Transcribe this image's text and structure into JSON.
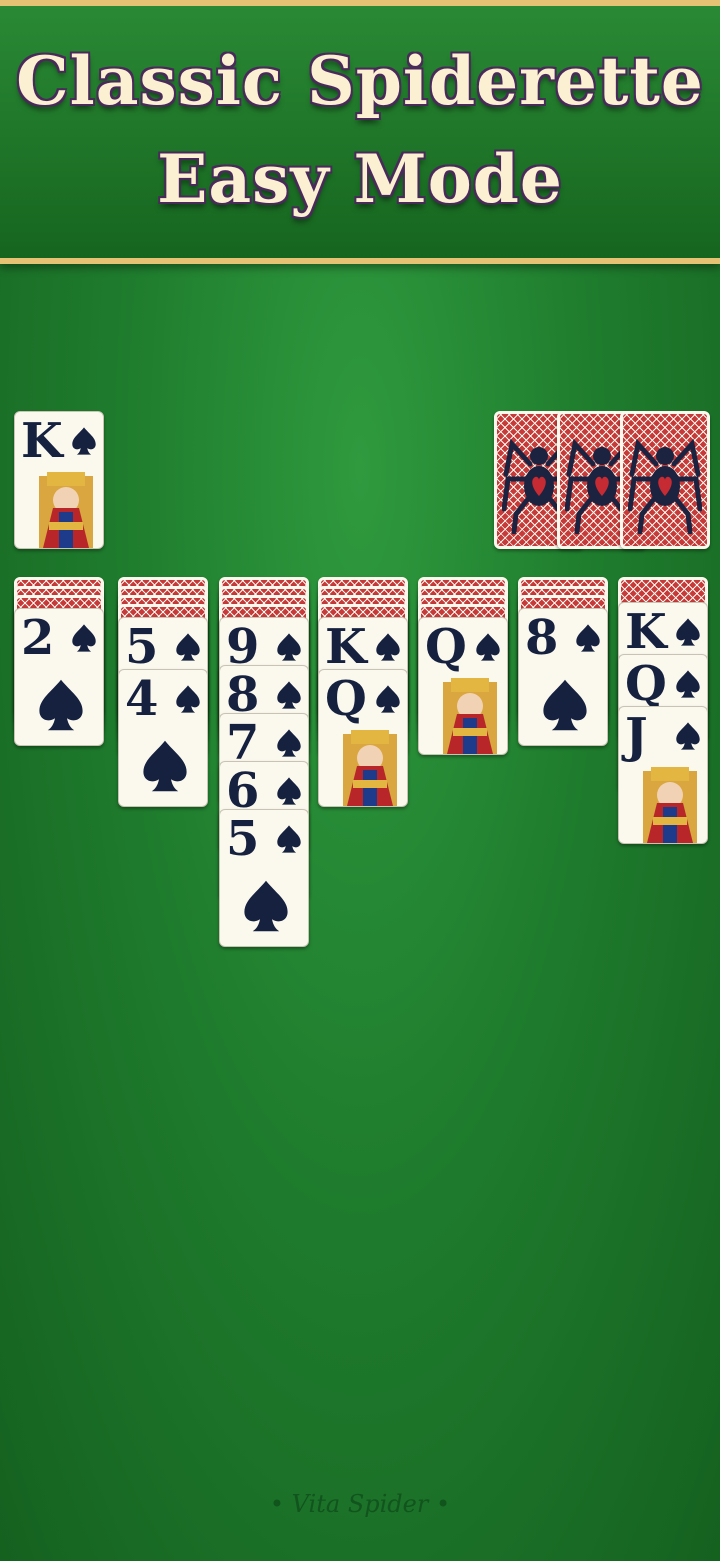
{
  "banner": {
    "line1": "Classic Spiderette",
    "line2": "Easy Mode"
  },
  "colors": {
    "felt": "#1f7d2e",
    "gold": "#e6c274",
    "ink": "#15213f",
    "back_red": "#c73a3a"
  },
  "foundation": [
    {
      "rank": "K",
      "suit": "spade-icon"
    }
  ],
  "stock_piles": 3,
  "tableau": [
    {
      "hidden": 3,
      "cards": [
        "2"
      ]
    },
    {
      "hidden": 4,
      "cards": [
        "5",
        "4"
      ]
    },
    {
      "hidden": 4,
      "cards": [
        "9",
        "8",
        "7",
        "6",
        "5"
      ]
    },
    {
      "hidden": 4,
      "cards": [
        "K",
        "Q"
      ]
    },
    {
      "hidden": 4,
      "cards": [
        "Q"
      ]
    },
    {
      "hidden": 3,
      "cards": [
        "8"
      ]
    },
    {
      "hidden": 1,
      "cards": [
        "K",
        "Q",
        "J"
      ]
    }
  ],
  "footer": "• Vita Spider •"
}
